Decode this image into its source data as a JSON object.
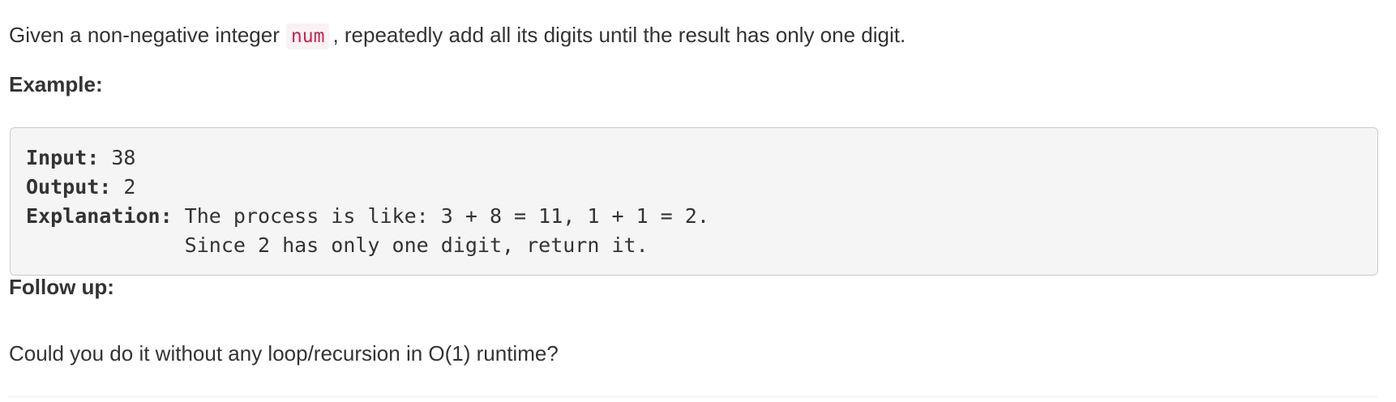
{
  "problem": {
    "intro_before": "Given a non-negative integer",
    "intro_code": "num",
    "intro_after": ", repeatedly add all its digits until the result has only one digit.",
    "example_heading": "Example:",
    "example": {
      "input_key": "Input:",
      "input_value": " 38",
      "output_key": "Output:",
      "output_value": " 2",
      "explanation_key": "Explanation:",
      "explanation_line1": " The process is like: 3 + 8 = 11, 1 + 1 = 2. ",
      "explanation_line2": "             Since 2 has only one digit, return it."
    },
    "followup_heading": "Follow up:",
    "followup_text": "Could you do it without any loop/recursion in O(1) runtime?"
  },
  "colors": {
    "text": "#333333",
    "code_text": "#c7254e",
    "code_background": "#f9f2f4",
    "pre_background": "#f5f5f5",
    "pre_border": "#cccccc"
  }
}
